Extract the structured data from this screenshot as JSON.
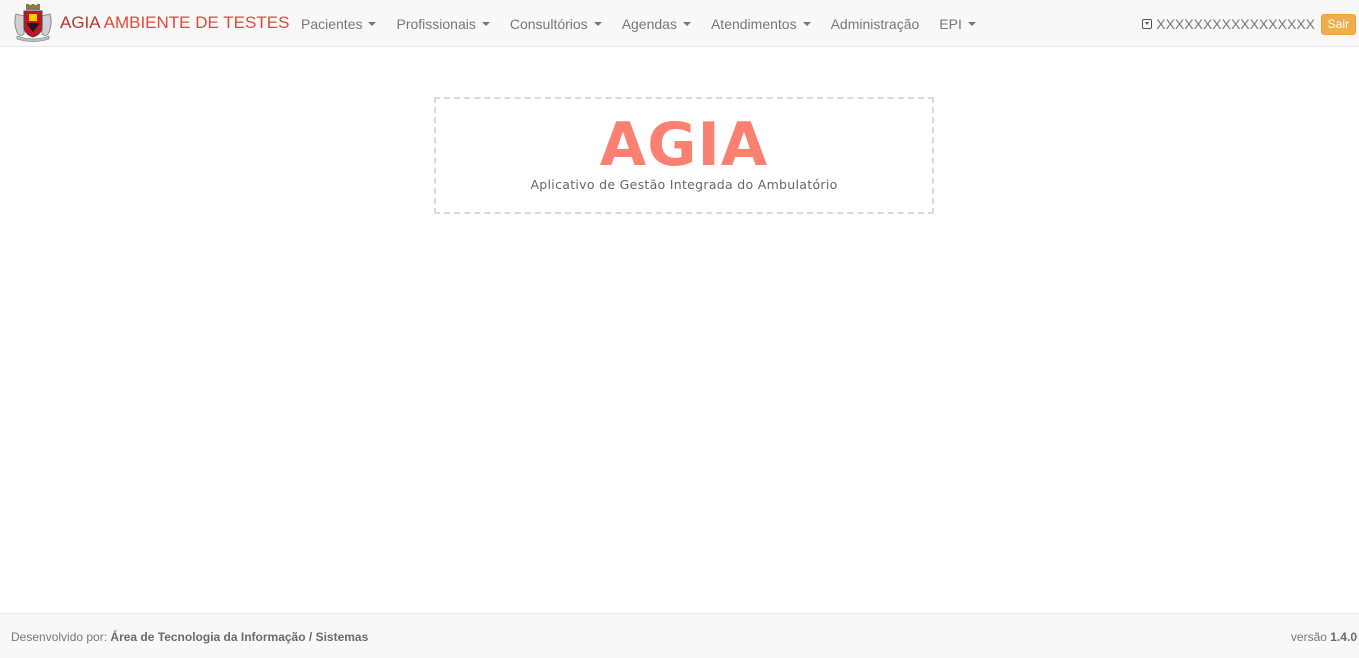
{
  "navbar": {
    "brand_name": "AGIA",
    "brand_environment": "AMBIENTE DE TESTES",
    "logo_icon": "coat-of-arms-icon",
    "menu": [
      {
        "label": "Pacientes",
        "has_dropdown": true
      },
      {
        "label": "Profissionais",
        "has_dropdown": true
      },
      {
        "label": "Consultórios",
        "has_dropdown": true
      },
      {
        "label": "Agendas",
        "has_dropdown": true
      },
      {
        "label": "Atendimentos",
        "has_dropdown": true
      },
      {
        "label": "Administração",
        "has_dropdown": false
      },
      {
        "label": "EPI",
        "has_dropdown": true
      }
    ],
    "user_icon": "caret-square-down-icon",
    "user_name": "XXXXXXXXXXXXXXXXX",
    "logout_label": "Sair"
  },
  "hero": {
    "title": "AGIA",
    "subtitle": "Aplicativo de Gestão Integrada do Ambulatório"
  },
  "footer": {
    "developed_by_label": "Desenvolvido por:",
    "developed_by_value": "Área de Tecnologia da Informação / Sistemas",
    "version_label": "versão",
    "version_value": "1.4.0"
  },
  "colors": {
    "brand_dark_red": "#b8352b",
    "brand_red": "#e4473a",
    "hero_salmon": "#fa8072",
    "logout_orange": "#f0ad4e",
    "navbar_bg": "#f8f8f8"
  }
}
